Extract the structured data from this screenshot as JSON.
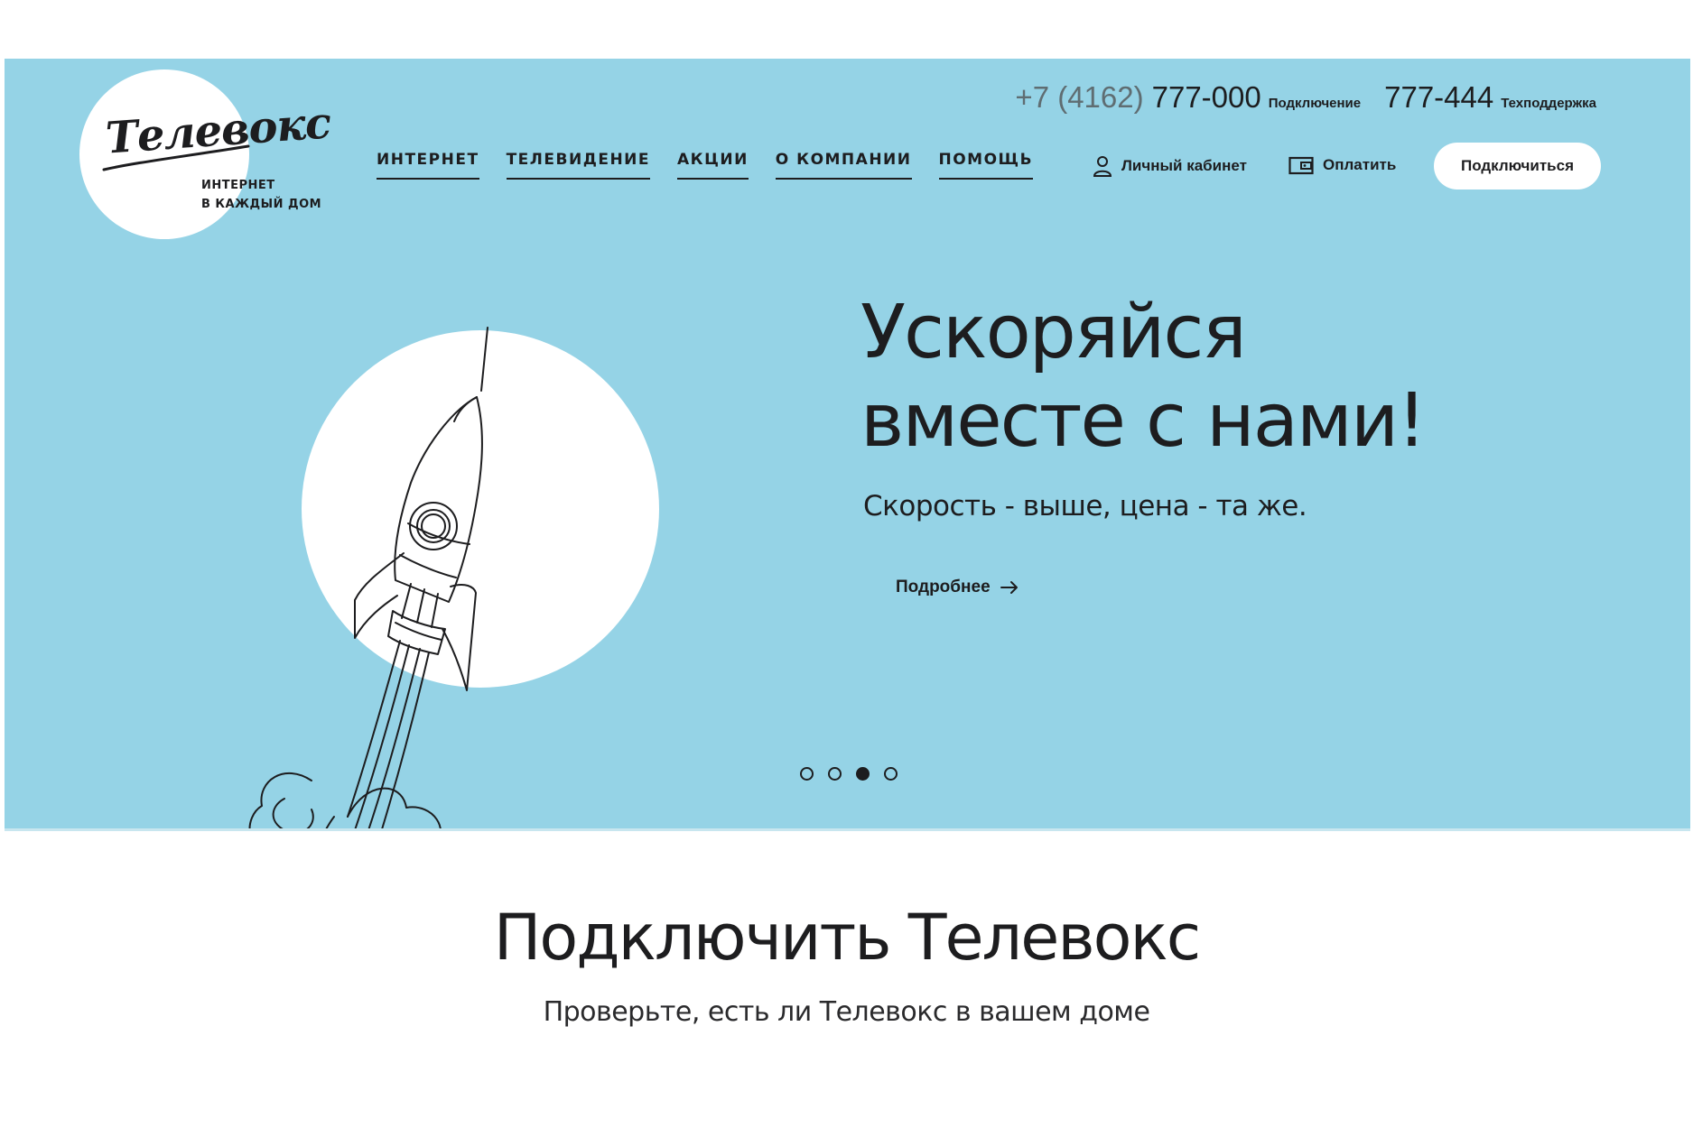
{
  "logo": {
    "script": "Телевокс",
    "tagline_line1": "ИНТЕРНЕТ",
    "tagline_line2": "В КАЖДЫЙ ДОМ"
  },
  "header": {
    "phone_prefix": "+7 (4162)",
    "phone_connect": "777-000",
    "phone_connect_label": "Подключение",
    "phone_support": "777-444",
    "phone_support_label": "Техподдержка",
    "nav": [
      {
        "label": "ИНТЕРНЕТ"
      },
      {
        "label": "ТЕЛЕВИДЕНИЕ"
      },
      {
        "label": "АКЦИИ"
      },
      {
        "label": "О КОМПАНИИ"
      },
      {
        "label": "ПОМОЩЬ"
      }
    ],
    "account_label": "Личный кабинет",
    "account_icon": "user-icon",
    "pay_label": "Оплатить",
    "pay_icon": "wallet-icon",
    "connect_button": "Подключиться"
  },
  "hero": {
    "title_line1": "Ускоряйся",
    "title_line2": "вместе с нами!",
    "subtitle": "Скорость - выше, цена - та же.",
    "more_link": "Подробнее",
    "more_icon": "arrow-right-icon",
    "illustration": "rocket-illustration",
    "slides_total": 4,
    "active_slide": 3
  },
  "connect_section": {
    "title": "Подключить Телевокс",
    "subtitle": "Проверьте, есть ли Телевокс в вашем доме"
  },
  "colors": {
    "hero_background": "#95d3e6",
    "text": "#1d1d1f",
    "white": "#ffffff"
  }
}
